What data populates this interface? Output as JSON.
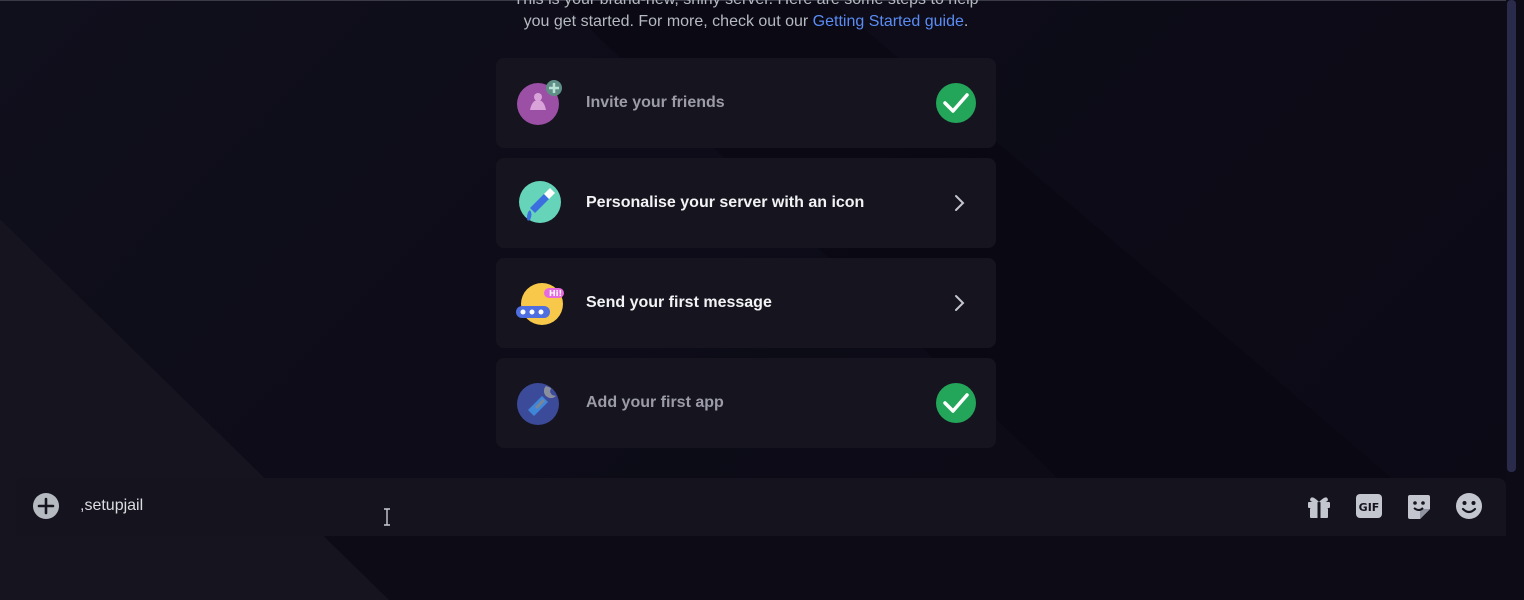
{
  "intro": {
    "line1": "This is your brand-new, shiny server. Here are some steps to help",
    "line2": "you get started. For more, check out our ",
    "link": "Getting Started guide",
    "after_link": "."
  },
  "steps": [
    {
      "label": "Invite your friends",
      "status": "done",
      "icon": "invite-friends-icon"
    },
    {
      "label": "Personalise your server with an icon",
      "status": "todo",
      "icon": "paintbrush-icon"
    },
    {
      "label": "Send your first message",
      "status": "todo",
      "icon": "chat-bubble-icon"
    },
    {
      "label": "Add your first app",
      "status": "done",
      "icon": "wrench-app-icon"
    }
  ],
  "composer": {
    "value": ",setupjail",
    "tools": [
      "gift-icon",
      "gif-icon",
      "sticker-icon",
      "emoji-icon"
    ],
    "gif_label": "GIF"
  },
  "colors": {
    "accent_link": "#5b8cf5",
    "success": "#23a55a"
  }
}
